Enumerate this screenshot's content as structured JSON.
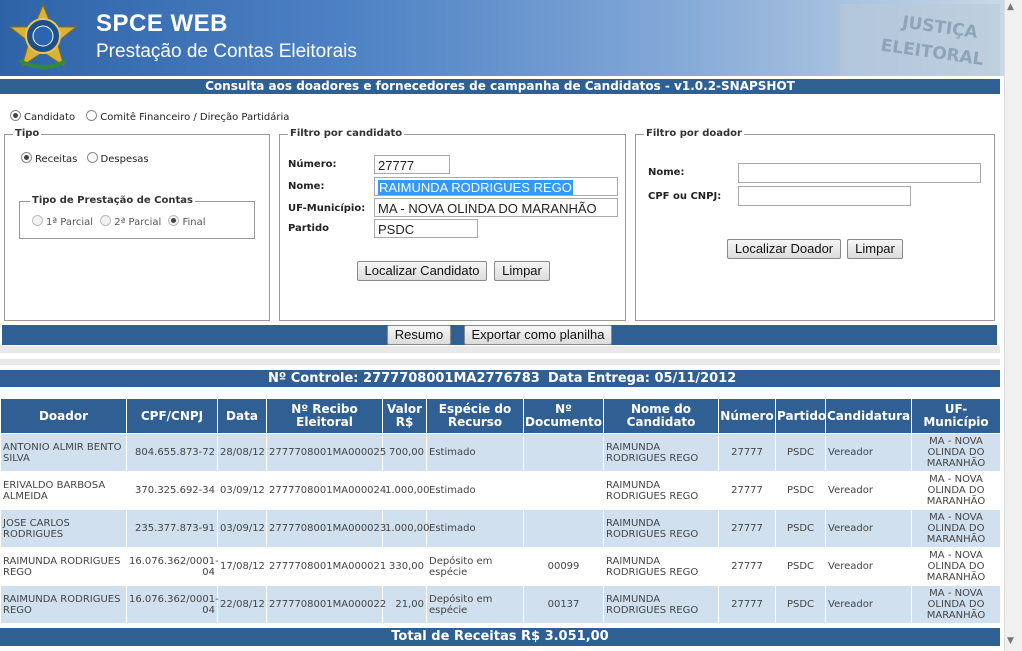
{
  "header": {
    "app_title": "SPCE WEB",
    "app_subtitle": "Prestação de Contas Eleitorais",
    "watermark_line1": "JUSTIÇA",
    "watermark_line2": "ELEITORAL"
  },
  "nav_title": "Consulta aos doadores e fornecedores de campanha de Candidatos - v1.0.2-SNAPSHOT",
  "scope": {
    "options": [
      "Candidato",
      "Comitê Financeiro / Direção Partidária"
    ],
    "selected": "Candidato"
  },
  "tipo": {
    "legend": "Tipo",
    "options": [
      "Receitas",
      "Despesas"
    ],
    "selected": "Receitas",
    "prestacao": {
      "legend": "Tipo de Prestação de Contas",
      "options": [
        "1ª Parcial",
        "2ª Parcial",
        "Final"
      ],
      "selected": "Final"
    }
  },
  "filtro_candidato": {
    "legend": "Filtro por candidato",
    "numero_label": "Número:",
    "numero_value": "27777",
    "nome_label": "Nome:",
    "nome_value": "RAIMUNDA RODRIGUES REGO",
    "uf_label": "UF-Município:",
    "uf_value": "MA - NOVA OLINDA DO MARANHÃO",
    "partido_label": "Partido",
    "partido_value": "PSDC",
    "localizar_label": "Localizar Candidato",
    "limpar_label": "Limpar"
  },
  "filtro_doador": {
    "legend": "Filtro por doador",
    "nome_label": "Nome:",
    "nome_value": "",
    "cpf_label": "CPF ou CNPJ:",
    "cpf_value": "",
    "localizar_label": "Localizar Doador",
    "limpar_label": "Limpar"
  },
  "actions": {
    "resumo_label": "Resumo",
    "exportar_label": "Exportar como planilha"
  },
  "controle": {
    "controle_text": "Nº Controle: 2777708001MA2776783",
    "entrega_text": "Data Entrega: 05/11/2012"
  },
  "table": {
    "columns": [
      "Doador",
      "CPF/CNPJ",
      "Data",
      "Nº Recibo Eleitoral",
      "Valor R$",
      "Espécie do Recurso",
      "Nº Documento",
      "Nome do Candidato",
      "Número",
      "Partido",
      "Candidatura",
      "UF-Município"
    ],
    "rows": [
      [
        "ANTONIO ALMIR BENTO SILVA",
        "804.655.873-72",
        "28/08/12",
        "2777708001MA000025",
        "700,00",
        "Estimado",
        "",
        "RAIMUNDA RODRIGUES REGO",
        "27777",
        "PSDC",
        "Vereador",
        "MA - NOVA OLINDA DO MARANHÃO"
      ],
      [
        "ERIVALDO BARBOSA ALMEIDA",
        "370.325.692-34",
        "03/09/12",
        "2777708001MA000024",
        "1.000,00",
        "Estimado",
        "",
        "RAIMUNDA RODRIGUES REGO",
        "27777",
        "PSDC",
        "Vereador",
        "MA - NOVA OLINDA DO MARANHÃO"
      ],
      [
        "JOSE CARLOS RODRIGUES",
        "235.377.873-91",
        "03/09/12",
        "2777708001MA000023",
        "1.000,00",
        "Estimado",
        "",
        "RAIMUNDA RODRIGUES REGO",
        "27777",
        "PSDC",
        "Vereador",
        "MA - NOVA OLINDA DO MARANHÃO"
      ],
      [
        "RAIMUNDA RODRIGUES REGO",
        "16.076.362/0001-04",
        "17/08/12",
        "2777708001MA000021",
        "330,00",
        "Depósito em espécie",
        "00099",
        "RAIMUNDA RODRIGUES REGO",
        "27777",
        "PSDC",
        "Vereador",
        "MA - NOVA OLINDA DO MARANHÃO"
      ],
      [
        "RAIMUNDA RODRIGUES REGO",
        "16.076.362/0001-04",
        "22/08/12",
        "2777708001MA000022",
        "21,00",
        "Depósito em espécie",
        "00137",
        "RAIMUNDA RODRIGUES REGO",
        "27777",
        "PSDC",
        "Vereador",
        "MA - NOVA OLINDA DO MARANHÃO"
      ]
    ],
    "total_text": "Total de Receitas R$ 3.051,00"
  }
}
